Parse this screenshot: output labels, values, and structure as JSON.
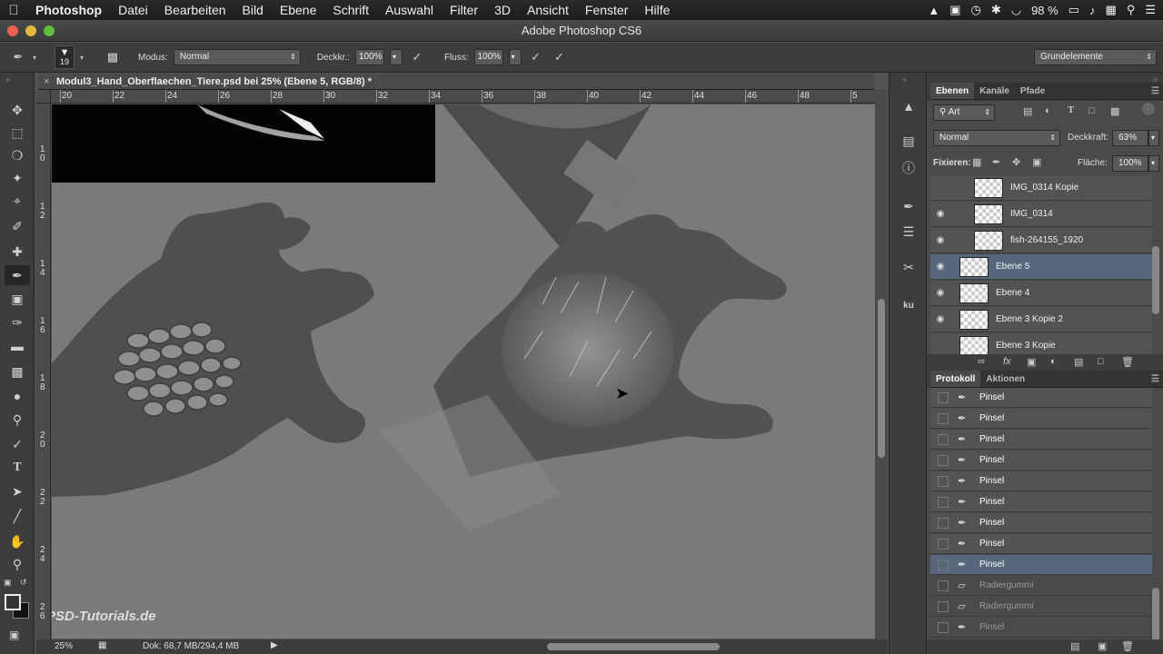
{
  "menubar": {
    "apple": "",
    "items": [
      "Photoshop",
      "Datei",
      "Bearbeiten",
      "Bild",
      "Ebene",
      "Schrift",
      "Auswahl",
      "Filter",
      "3D",
      "Ansicht",
      "Fenster",
      "Hilfe"
    ],
    "battery": "98 %"
  },
  "window": {
    "title": "Adobe Photoshop CS6"
  },
  "options": {
    "brush_size": "19",
    "mode_label": "Modus:",
    "mode_value": "Normal",
    "opacity_label": "Deckkr.:",
    "opacity_value": "100%",
    "flow_label": "Fluss:",
    "flow_value": "100%",
    "workspace": "Grundelemente"
  },
  "document": {
    "tab_title": "Modul3_Hand_Oberflaechen_Tiere.psd bei 25% (Ebene 5, RGB/8) *",
    "hruler": [
      "20",
      "22",
      "24",
      "26",
      "28",
      "30",
      "32",
      "34",
      "36",
      "38",
      "40",
      "42",
      "44",
      "46",
      "48",
      "5"
    ],
    "vruler": [
      "1\n0",
      "1\n2",
      "1\n4",
      "1\n6",
      "1\n8",
      "2\n0",
      "2\n2",
      "2\n4",
      "2\n6"
    ],
    "zoom": "25%",
    "doc_size": "Dok: 68,7 MB/294,4 MB",
    "watermark": "PSD-Tutorials.de"
  },
  "layers_panel": {
    "tabs": [
      "Ebenen",
      "Kanäle",
      "Pfade"
    ],
    "filter": "Art",
    "blend": "Normal",
    "opacity_label": "Deckkraft:",
    "opacity_value": "63%",
    "lock_label": "Fixieren:",
    "fill_label": "Fläche:",
    "fill_value": "100%",
    "layers": [
      {
        "name": "IMG_0314 Kopie",
        "visible": false,
        "selected": false,
        "indent": true
      },
      {
        "name": "IMG_0314",
        "visible": true,
        "selected": false,
        "indent": true
      },
      {
        "name": "fish-264155_1920",
        "visible": true,
        "selected": false,
        "indent": true
      },
      {
        "name": "Ebene 5",
        "visible": true,
        "selected": true,
        "indent": false
      },
      {
        "name": "Ebene 4",
        "visible": true,
        "selected": false,
        "indent": false
      },
      {
        "name": "Ebene 3 Kopie 2",
        "visible": true,
        "selected": false,
        "indent": false
      },
      {
        "name": "Ebene 3 Kopie",
        "visible": false,
        "selected": false,
        "indent": false
      }
    ]
  },
  "history_panel": {
    "tabs": [
      "Protokoll",
      "Aktionen"
    ],
    "items": [
      {
        "name": "Pinsel",
        "state": "normal"
      },
      {
        "name": "Pinsel",
        "state": "normal"
      },
      {
        "name": "Pinsel",
        "state": "normal"
      },
      {
        "name": "Pinsel",
        "state": "normal"
      },
      {
        "name": "Pinsel",
        "state": "normal"
      },
      {
        "name": "Pinsel",
        "state": "normal"
      },
      {
        "name": "Pinsel",
        "state": "normal"
      },
      {
        "name": "Pinsel",
        "state": "normal"
      },
      {
        "name": "Pinsel",
        "state": "selected"
      },
      {
        "name": "Radiergummi",
        "state": "dim"
      },
      {
        "name": "Radiergummi",
        "state": "dim"
      },
      {
        "name": "Pinsel",
        "state": "dim"
      }
    ]
  }
}
